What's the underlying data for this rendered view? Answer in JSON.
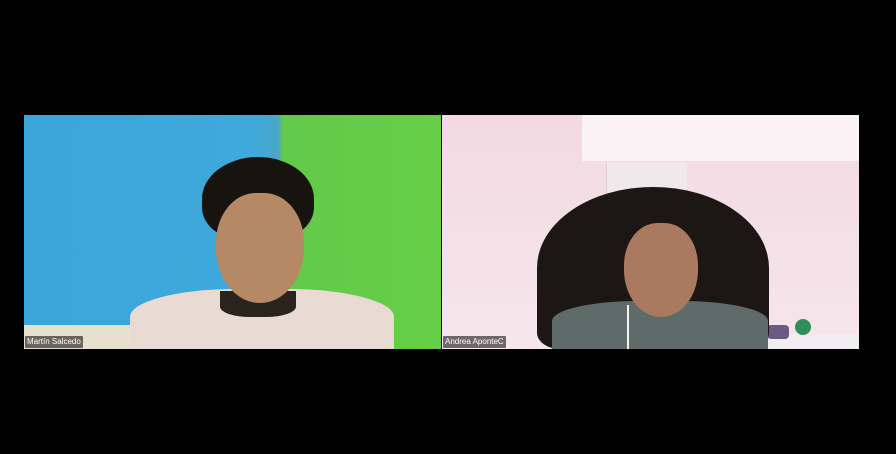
{
  "participants": [
    {
      "name": "Martín Salcedo"
    },
    {
      "name": "Andrea AponteC"
    }
  ]
}
